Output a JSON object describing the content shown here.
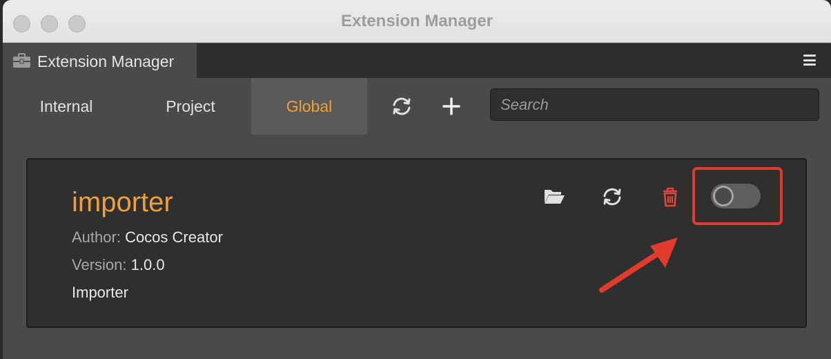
{
  "window": {
    "title": "Extension Manager"
  },
  "panel": {
    "tab_label": "Extension Manager",
    "tab_icon": "toolbox-icon",
    "menu_icon": "hamburger-menu-icon"
  },
  "tabs": [
    {
      "label": "Internal",
      "active": false
    },
    {
      "label": "Project",
      "active": false
    },
    {
      "label": "Global",
      "active": true
    }
  ],
  "toolbar": {
    "refresh_icon": "refresh-icon",
    "add_icon": "plus-icon"
  },
  "search": {
    "placeholder": "Search",
    "value": ""
  },
  "extension": {
    "name": "importer",
    "author_label": "Author:",
    "author": "Cocos Creator",
    "version_label": "Version:",
    "version": "1.0.0",
    "description": "Importer",
    "enabled": false,
    "actions": [
      "folder-open-icon",
      "refresh-icon",
      "trash-icon"
    ]
  },
  "annotation": {
    "highlight_color": "#e23a2c",
    "target": "enable-toggle"
  },
  "colors": {
    "accent": "#f0a03a",
    "danger": "#e0483c"
  }
}
